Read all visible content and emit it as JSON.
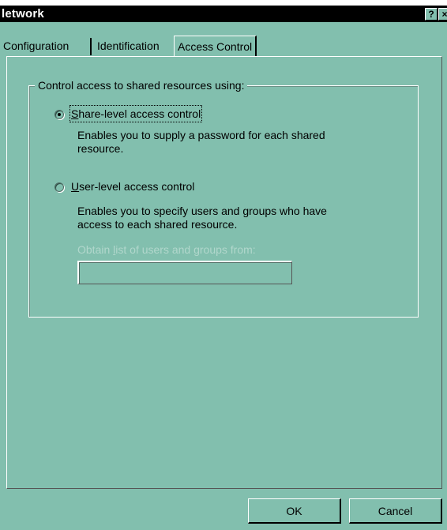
{
  "window": {
    "title": "letwork",
    "help_glyph": "?",
    "close_glyph": "×"
  },
  "tabs": [
    {
      "label": "Configuration",
      "active": false
    },
    {
      "label": "Identification",
      "active": false
    },
    {
      "label": "Access Control",
      "active": true
    }
  ],
  "group": {
    "legend": "Control access to shared resources using:",
    "options": [
      {
        "mnemonic": "S",
        "label_rest": "hare-level access control",
        "selected": true,
        "description_line1": "Enables you to supply a password for each shared",
        "description_line2": "resource."
      },
      {
        "mnemonic": "U",
        "label_rest": "ser-level access control",
        "selected": false,
        "description_line1": "Enables you to specify users and groups who have",
        "description_line2": "access to each shared resource."
      }
    ],
    "obtain_label_pre": "Obtain ",
    "obtain_label_mnemonic": "l",
    "obtain_label_post": "ist of users and groups from:",
    "obtain_value": ""
  },
  "buttons": {
    "ok": "OK",
    "cancel": "Cancel"
  },
  "colors": {
    "dialog_face": "#82bfae",
    "title_bar": "#000000",
    "disabled_text": "#b1d7cc"
  }
}
